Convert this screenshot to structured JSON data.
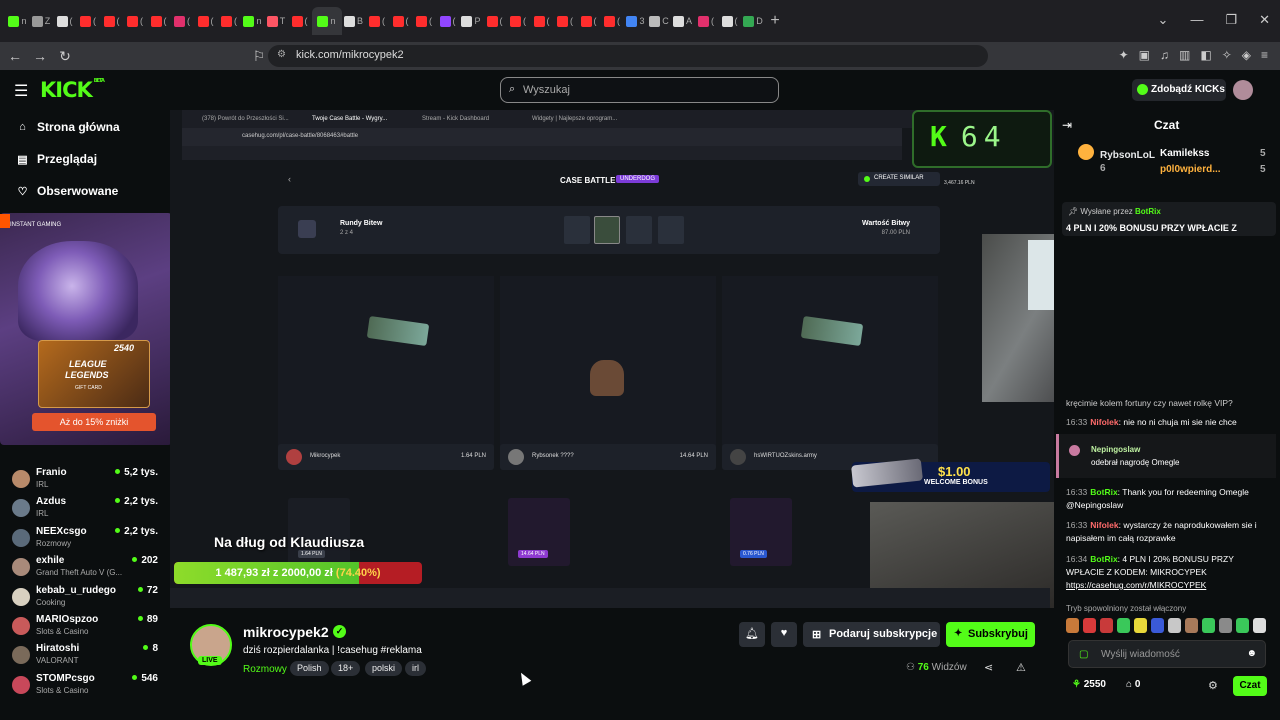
{
  "browser": {
    "tabs": [
      {
        "icon": "kick",
        "label": "n",
        "color": "#53fc18"
      },
      {
        "icon": "z",
        "label": "Z",
        "color": "#999"
      },
      {
        "icon": "x",
        "label": "(",
        "color": "#ddd"
      },
      {
        "icon": "yt",
        "label": "(",
        "color": "#ff2d2d"
      },
      {
        "icon": "yt",
        "label": "(",
        "color": "#ff2d2d"
      },
      {
        "icon": "yt",
        "label": "(",
        "color": "#ff2d2d"
      },
      {
        "icon": "yt",
        "label": "(",
        "color": "#ff2d2d"
      },
      {
        "icon": "ig",
        "label": "(",
        "color": "#e1306c"
      },
      {
        "icon": "yt",
        "label": "(",
        "color": "#ff2d2d"
      },
      {
        "icon": "yt",
        "label": "(",
        "color": "#ff2d2d"
      },
      {
        "icon": "kick",
        "label": "n",
        "color": "#53fc18"
      },
      {
        "icon": "tinder",
        "label": "T",
        "color": "#fd5564"
      },
      {
        "icon": "yt",
        "label": "(",
        "color": "#ff2d2d"
      },
      {
        "icon": "kick",
        "label": "n",
        "color": "#53fc18"
      },
      {
        "icon": "x",
        "label": "B",
        "color": "#ddd"
      },
      {
        "icon": "yt",
        "label": "(",
        "color": "#ff2d2d"
      },
      {
        "icon": "yt",
        "label": "(",
        "color": "#ff2d2d"
      },
      {
        "icon": "yt",
        "label": "(",
        "color": "#ff2d2d"
      },
      {
        "icon": "twitch",
        "label": "(",
        "color": "#9146ff"
      },
      {
        "icon": "p",
        "label": "P",
        "color": "#ddd"
      },
      {
        "icon": "yt",
        "label": "(",
        "color": "#ff2d2d"
      },
      {
        "icon": "yt",
        "label": "(",
        "color": "#ff2d2d"
      },
      {
        "icon": "yt",
        "label": "(",
        "color": "#ff2d2d"
      },
      {
        "icon": "yt",
        "label": "(",
        "color": "#ff2d2d"
      },
      {
        "icon": "yt",
        "label": "(",
        "color": "#ff2d2d"
      },
      {
        "icon": "yt",
        "label": "(",
        "color": "#ff2d2d"
      },
      {
        "icon": "chrome",
        "label": "3",
        "color": "#4285f4"
      },
      {
        "icon": "c",
        "label": "C",
        "color": "#bbb"
      },
      {
        "icon": "a",
        "label": "A",
        "color": "#ddd"
      },
      {
        "icon": "ig",
        "label": "(",
        "color": "#e1306c"
      },
      {
        "icon": "tiktok",
        "label": "(",
        "color": "#ddd"
      },
      {
        "icon": "maps",
        "label": "D",
        "color": "#34a853"
      }
    ],
    "active_tab_index": 13,
    "url": "kick.com/mikrocypek2"
  },
  "header": {
    "logo": "KICK",
    "logo_beta": "BETA",
    "search_placeholder": "Wyszukaj",
    "kicks_button": "Zdobądź KICKs"
  },
  "sidebar": {
    "nav": [
      {
        "label": "Strona główna",
        "icon": "home-icon"
      },
      {
        "label": "Przeglądaj",
        "icon": "browse-icon"
      },
      {
        "label": "Obserwowane",
        "icon": "heart-icon"
      }
    ],
    "promo": {
      "brand": "INSTANT GAMING",
      "product_line1": "LEAGUE",
      "product_line2": "LEGENDS",
      "product_sub": "GIFT CARD",
      "price": "2540",
      "offer": "Aż do 15% zniżki"
    },
    "channels": [
      {
        "name": "Franio",
        "category": "IRL",
        "viewers": "5,2 tys.",
        "avatar_color": "#b88a6a"
      },
      {
        "name": "Azdus",
        "category": "IRL",
        "viewers": "2,2 tys.",
        "avatar_color": "#6a7a8a"
      },
      {
        "name": "NEEXcsgo",
        "category": "Rozmowy",
        "viewers": "2,2 tys.",
        "avatar_color": "#5a6a7a"
      },
      {
        "name": "exhile",
        "category": "Grand Theft Auto V (G...",
        "viewers": "202",
        "avatar_color": "#a88a7a"
      },
      {
        "name": "kebab_u_rudego",
        "category": "Cooking",
        "viewers": "72",
        "avatar_color": "#d8d0c0"
      },
      {
        "name": "MARIOspzoo",
        "category": "Slots & Casino",
        "viewers": "89",
        "avatar_color": "#c85a5a"
      },
      {
        "name": "Hiratoshi",
        "category": "VALORANT",
        "viewers": "8",
        "avatar_color": "#7a6a5a"
      },
      {
        "name": "STOMPcsgo",
        "category": "Slots & Casino",
        "viewers": "546",
        "avatar_color": "#c8485a"
      }
    ]
  },
  "stream": {
    "inner_tabs": [
      "(378) Powrót do Przeszłości Si...",
      "Twoje Case Battle - Wygry...",
      "Stream - Kick Dashboard",
      "Widgety | Najlepsze oprogram..."
    ],
    "inner_url": "casehug.com/pl/case-battle/8068463#battle",
    "case_battle_title": "CASE BATTLE",
    "case_battle_badge": "UNDERDOG",
    "create_similar": "CREATE SIMILAR",
    "k_counter_letter": "K",
    "k_counter_value": "64",
    "balance": "3,467.16 PLN",
    "rounds_label": "Rundy Bitew",
    "rounds_value": "2 z 4",
    "battle_value_label": "Wartość Bitwy",
    "battle_value": "87.00 PLN",
    "players": [
      {
        "name": "Mikrocypek",
        "value": "1.64 PLN"
      },
      {
        "name": "Rybsonek ????",
        "value": "14.64 PLN"
      },
      {
        "name": "hsWIRTUOZskins.army",
        "value": ""
      }
    ],
    "items": [
      {
        "name": "1.64 PLN"
      },
      {
        "name": "14.64 PLN"
      },
      {
        "name": "0.76 PLN"
      }
    ],
    "bonus_amount": "$1.00",
    "bonus_label": "WELCOME BONUS",
    "goal_title": "Na dług od Klaudiusza",
    "goal_current": "1 487,93 zł",
    "goal_separator": "z",
    "goal_target": "2000,00 zł",
    "goal_percent_text": "(74.40%)",
    "goal_fraction": 0.744
  },
  "streamer": {
    "name": "mikrocypek2",
    "live": "LIVE",
    "title": "dziś rozpierdalanka | !casehug #reklama",
    "category": "Rozmowy",
    "tags": [
      "Polish",
      "18+",
      "polski",
      "irl"
    ],
    "gift_button": "Podaruj subskrypcje",
    "subscribe_button": "Subskrybuj",
    "viewers_count": "76",
    "viewers_label": "Widzów"
  },
  "chat": {
    "title": "Czat",
    "leaderboard": [
      {
        "name": "RybsonLoL",
        "count": "6",
        "color": "#ffb23e"
      },
      {
        "name": "Kamilekss",
        "count": "5",
        "color": "#ffffff"
      },
      {
        "name": "p0l0wpierd...",
        "count": "5",
        "color": "#ffb23e"
      }
    ],
    "pinned_by_prefix": "Wysłane przez",
    "pinned_by": "BotRix",
    "pinned_message": "4 PLN I 20% BONUSU PRZY WPŁACIE Z",
    "messages": [
      {
        "time": "",
        "user": "",
        "text": "kręcimie kolem fortuny czy nawet rolkę VIP?",
        "user_color": "#ffffff"
      },
      {
        "time": "16:33",
        "user": "Nifolek",
        "text": "nie no ni chuja mi sie nie chce",
        "user_color": "#ff6b6b"
      },
      {
        "time": "16:33",
        "user": "BotRix",
        "text": "Thank you for redeeming Omegle @Nepingoslaw",
        "user_color": "#53fc18"
      },
      {
        "time": "16:33",
        "user": "Nifolek",
        "text": "wystarczy że naprodukowałem sie i napisałem im całą rozprawke",
        "user_color": "#ff6b6b"
      },
      {
        "time": "16:34",
        "user": "BotRix",
        "text": "4 PLN I 20% BONUSU PRZY WPŁACIE Z KODEM: MIKROCYPEK",
        "user_color": "#53fc18",
        "link": "https://casehug.com/r/MIKROCYPEK"
      }
    ],
    "redeem": {
      "user": "Nepingoslaw",
      "text": "odebrał nagrodę Omegle"
    },
    "slow_mode": "Tryb spowolniony został włączony",
    "input_placeholder": "Wyślij wiadomość",
    "points": "2550",
    "bank": "0",
    "send_button": "Czat"
  }
}
